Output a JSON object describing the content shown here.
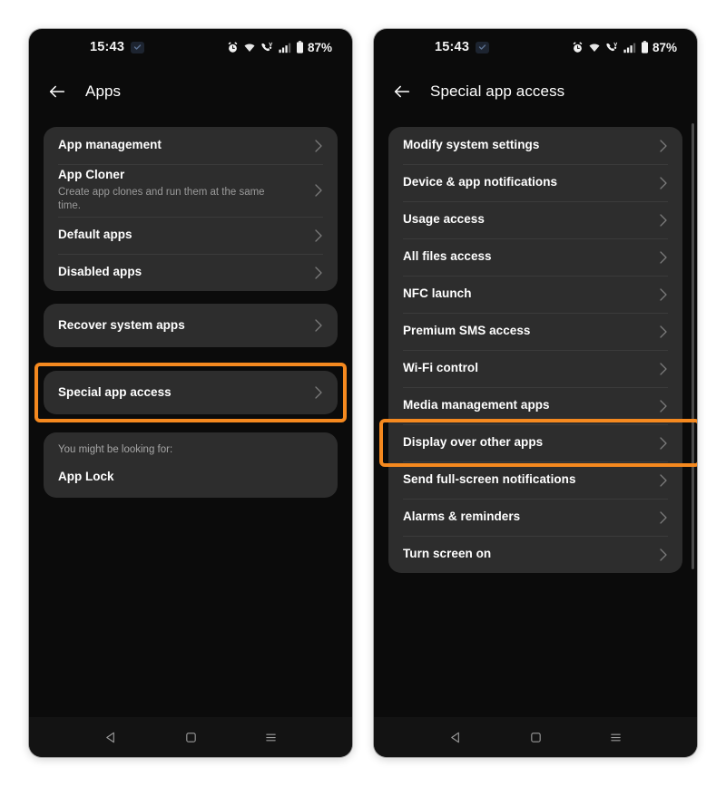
{
  "colors": {
    "page_background": "#ffffff",
    "phone_background": "#0b0b0b",
    "card_background": "#2d2d2d",
    "highlight_orange": "#F5891F",
    "primary_text": "#ffffff",
    "secondary_text": "#9a9a9a"
  },
  "phones": [
    {
      "id": "left",
      "status_bar": {
        "time": "15:43",
        "badge_icon": "notification-badge-icon",
        "icons": [
          "alarm-icon",
          "wifi-icon",
          "volte-call-icon",
          "signal-bars-icon",
          "battery-icon"
        ],
        "battery_percent": "87%"
      },
      "app_bar": {
        "back_icon": "back-arrow-icon",
        "title": "Apps"
      },
      "cards": [
        {
          "name": "apps-primary-card",
          "rows": [
            {
              "title": "App management",
              "subtitle": "",
              "chevron": true,
              "highlighted": false
            },
            {
              "title": "App Cloner",
              "subtitle": "Create app clones and run them at the same time.",
              "chevron": true,
              "highlighted": false
            },
            {
              "title": "Default apps",
              "subtitle": "",
              "chevron": true,
              "highlighted": false
            },
            {
              "title": "Disabled apps",
              "subtitle": "",
              "chevron": true,
              "highlighted": false
            }
          ]
        },
        {
          "name": "recover-system-apps-card",
          "rows": [
            {
              "title": "Recover system apps",
              "subtitle": "",
              "chevron": true,
              "highlighted": false
            }
          ]
        },
        {
          "name": "special-app-access-card",
          "rows": [
            {
              "title": "Special app access",
              "subtitle": "",
              "chevron": true,
              "highlighted": true
            }
          ]
        }
      ],
      "suggestion_card": {
        "label": "You might be looking for:",
        "items": [
          "App Lock"
        ]
      },
      "nav_bar": [
        "back-triangle-icon",
        "home-square-icon",
        "recents-menu-icon"
      ]
    },
    {
      "id": "right",
      "status_bar": {
        "time": "15:43",
        "badge_icon": "notification-badge-icon",
        "icons": [
          "alarm-icon",
          "wifi-icon",
          "volte-call-icon",
          "signal-bars-icon",
          "battery-icon"
        ],
        "battery_percent": "87%"
      },
      "app_bar": {
        "back_icon": "back-arrow-icon",
        "title": "Special app access"
      },
      "cards": [
        {
          "name": "special-app-access-list-card",
          "rows": [
            {
              "title": "Modify system settings",
              "subtitle": "",
              "chevron": true,
              "highlighted": false
            },
            {
              "title": "Device & app notifications",
              "subtitle": "",
              "chevron": true,
              "highlighted": false
            },
            {
              "title": "Usage access",
              "subtitle": "",
              "chevron": true,
              "highlighted": false
            },
            {
              "title": "All files access",
              "subtitle": "",
              "chevron": true,
              "highlighted": false
            },
            {
              "title": "NFC launch",
              "subtitle": "",
              "chevron": true,
              "highlighted": false
            },
            {
              "title": "Premium SMS access",
              "subtitle": "",
              "chevron": true,
              "highlighted": false
            },
            {
              "title": "Wi-Fi control",
              "subtitle": "",
              "chevron": true,
              "highlighted": false
            },
            {
              "title": "Media management apps",
              "subtitle": "",
              "chevron": true,
              "highlighted": false
            },
            {
              "title": "Display over other apps",
              "subtitle": "",
              "chevron": true,
              "highlighted": true
            },
            {
              "title": "Send full-screen notifications",
              "subtitle": "",
              "chevron": true,
              "highlighted": false
            },
            {
              "title": "Alarms & reminders",
              "subtitle": "",
              "chevron": true,
              "highlighted": false
            },
            {
              "title": "Turn screen on",
              "subtitle": "",
              "chevron": true,
              "highlighted": false
            }
          ]
        }
      ],
      "nav_bar": [
        "back-triangle-icon",
        "home-square-icon",
        "recents-menu-icon"
      ]
    }
  ]
}
